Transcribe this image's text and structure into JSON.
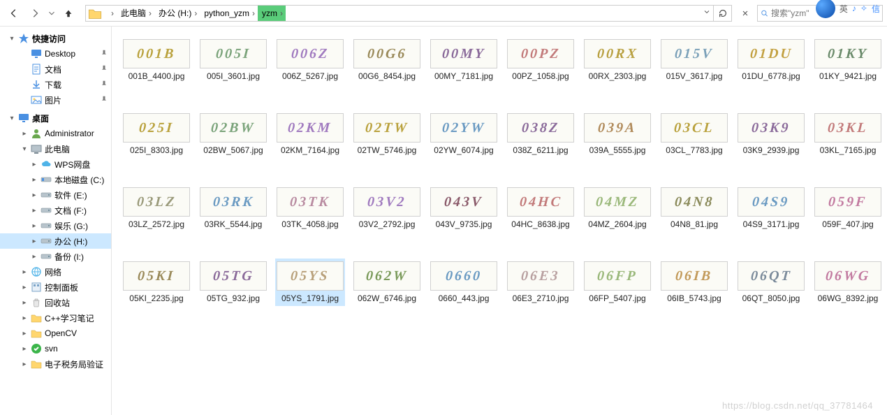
{
  "breadcrumb": {
    "items": [
      "此电脑",
      "办公 (H:)",
      "python_yzm",
      "yzm"
    ],
    "highlighted_index": 3
  },
  "search": {
    "placeholder": "搜索\"yzm\""
  },
  "top_extra": {
    "ime": "英",
    "sig": "信"
  },
  "sidebar": [
    {
      "label": "快捷访问",
      "icon": "star",
      "indent": 0,
      "twisty": "▾",
      "bold": true
    },
    {
      "label": "Desktop",
      "icon": "monitor",
      "indent": 1,
      "pin": true
    },
    {
      "label": "文档",
      "icon": "doc",
      "indent": 1,
      "pin": true
    },
    {
      "label": "下载",
      "icon": "download",
      "indent": 1,
      "pin": true
    },
    {
      "label": "图片",
      "icon": "pic",
      "indent": 1,
      "pin": true
    },
    {
      "sep": true
    },
    {
      "label": "桌面",
      "icon": "monitor",
      "indent": 0,
      "twisty": "▾",
      "bold": true
    },
    {
      "label": "Administrator",
      "icon": "person",
      "indent": 1,
      "twisty": "▸"
    },
    {
      "label": "此电脑",
      "icon": "pc",
      "indent": 1,
      "twisty": "▾"
    },
    {
      "label": "WPS网盘",
      "icon": "cloud",
      "indent": 2,
      "twisty": "▸"
    },
    {
      "label": "本地磁盘 (C:)",
      "icon": "drive-sys",
      "indent": 2,
      "twisty": "▸"
    },
    {
      "label": "软件 (E:)",
      "icon": "drive",
      "indent": 2,
      "twisty": "▸"
    },
    {
      "label": "文档 (F:)",
      "icon": "drive",
      "indent": 2,
      "twisty": "▸"
    },
    {
      "label": "娱乐 (G:)",
      "icon": "drive",
      "indent": 2,
      "twisty": "▸"
    },
    {
      "label": "办公 (H:)",
      "icon": "drive",
      "indent": 2,
      "twisty": "▸",
      "selected": true
    },
    {
      "label": "备份 (I:)",
      "icon": "drive",
      "indent": 2,
      "twisty": "▸"
    },
    {
      "label": "网络",
      "icon": "net",
      "indent": 1,
      "twisty": "▸"
    },
    {
      "label": "控制面板",
      "icon": "panel",
      "indent": 1,
      "twisty": "▸"
    },
    {
      "label": "回收站",
      "icon": "recycle",
      "indent": 1,
      "twisty": "▸"
    },
    {
      "label": "C++学习笔记",
      "icon": "folder",
      "indent": 1,
      "twisty": "▸"
    },
    {
      "label": "OpenCV",
      "icon": "folder",
      "indent": 1,
      "twisty": "▸"
    },
    {
      "label": "svn",
      "icon": "svn",
      "indent": 1,
      "twisty": "▸"
    },
    {
      "label": "电子税务局验证",
      "icon": "folder",
      "indent": 1,
      "twisty": "▸",
      "truncated": true
    }
  ],
  "files": [
    {
      "name": "001B_4400.jpg",
      "text": "001B",
      "color": "#b9a13c"
    },
    {
      "name": "005I_3601.jpg",
      "text": "005I",
      "color": "#7aa37a"
    },
    {
      "name": "006Z_5267.jpg",
      "text": "006Z",
      "color": "#a07abf"
    },
    {
      "name": "00G6_8454.jpg",
      "text": "00G6",
      "color": "#9a8a5a"
    },
    {
      "name": "00MY_7181.jpg",
      "text": "00MY",
      "color": "#8a6a9a"
    },
    {
      "name": "00PZ_1058.jpg",
      "text": "00PZ",
      "color": "#c27a7a"
    },
    {
      "name": "00RX_2303.jpg",
      "text": "00RX",
      "color": "#b8a040"
    },
    {
      "name": "015V_3617.jpg",
      "text": "015V",
      "color": "#7aa0b8"
    },
    {
      "name": "01DU_6778.jpg",
      "text": "01DU",
      "color": "#c2a040"
    },
    {
      "name": "01KY_9421.jpg",
      "text": "01KY",
      "color": "#6a8a6a"
    },
    {
      "name": "025I_8303.jpg",
      "text": "025I",
      "color": "#b9a13c"
    },
    {
      "name": "02BW_5067.jpg",
      "text": "02BW",
      "color": "#7aa37a"
    },
    {
      "name": "02KM_7164.jpg",
      "text": "02KM",
      "color": "#a07abf"
    },
    {
      "name": "02TW_5746.jpg",
      "text": "02TW",
      "color": "#b9a13c"
    },
    {
      "name": "02YW_6074.jpg",
      "text": "02YW",
      "color": "#6a9ac2"
    },
    {
      "name": "038Z_6211.jpg",
      "text": "038Z",
      "color": "#8a6a9a"
    },
    {
      "name": "039A_5555.jpg",
      "text": "039A",
      "color": "#b08a5a"
    },
    {
      "name": "03CL_7783.jpg",
      "text": "03CL",
      "color": "#b9a13c"
    },
    {
      "name": "03K9_2939.jpg",
      "text": "03K9",
      "color": "#8a6a9a"
    },
    {
      "name": "03KL_7165.jpg",
      "text": "03KL",
      "color": "#c27a7a"
    },
    {
      "name": "03LZ_2572.jpg",
      "text": "03LZ",
      "color": "#9a9a7a"
    },
    {
      "name": "03RK_5544.jpg",
      "text": "03RK",
      "color": "#6a9ac2"
    },
    {
      "name": "03TK_4058.jpg",
      "text": "03TK",
      "color": "#b88aa0"
    },
    {
      "name": "03V2_2792.jpg",
      "text": "03V2",
      "color": "#a07abf"
    },
    {
      "name": "043V_9735.jpg",
      "text": "043V",
      "color": "#8a5a6a"
    },
    {
      "name": "04HC_8638.jpg",
      "text": "04HC",
      "color": "#c27a7a"
    },
    {
      "name": "04MZ_2604.jpg",
      "text": "04MZ",
      "color": "#9ab87a"
    },
    {
      "name": "04N8_81.jpg",
      "text": "04N8",
      "color": "#8a8a5a"
    },
    {
      "name": "04S9_3171.jpg",
      "text": "04S9",
      "color": "#6a9ac2"
    },
    {
      "name": "059F_407.jpg",
      "text": "059F",
      "color": "#c27aa0"
    },
    {
      "name": "05KI_2235.jpg",
      "text": "05KI",
      "color": "#9a8a5a"
    },
    {
      "name": "05TG_932.jpg",
      "text": "05TG",
      "color": "#8a6a9a"
    },
    {
      "name": "05YS_1791.jpg",
      "text": "05YS",
      "color": "#b8a07a",
      "selected": true
    },
    {
      "name": "062W_6746.jpg",
      "text": "062W",
      "color": "#7a9a5a"
    },
    {
      "name": "0660_443.jpg",
      "text": "0660",
      "color": "#6a9ac2"
    },
    {
      "name": "06E3_2710.jpg",
      "text": "06E3",
      "color": "#b8a0a0"
    },
    {
      "name": "06FP_5407.jpg",
      "text": "06FP",
      "color": "#9ab87a"
    },
    {
      "name": "06IB_5743.jpg",
      "text": "06IB",
      "color": "#c29a5a"
    },
    {
      "name": "06QT_8050.jpg",
      "text": "06QT",
      "color": "#7a8a9a"
    },
    {
      "name": "06WG_8392.jpg",
      "text": "06WG",
      "color": "#c27aa0"
    }
  ],
  "watermark": "https://blog.csdn.net/qq_37781464",
  "status": ""
}
